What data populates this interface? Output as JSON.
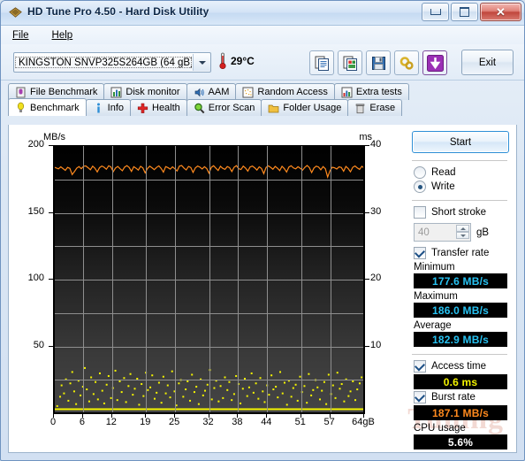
{
  "window": {
    "title": "HD Tune Pro 4.50 - Hard Disk Utility",
    "app_icon": "hdtune-diamond-icon",
    "minimize_label": "",
    "maximize_label": "",
    "close_label": "✕"
  },
  "menu": {
    "items": [
      {
        "label": "File",
        "accel": "F"
      },
      {
        "label": "Help",
        "accel": "H"
      }
    ]
  },
  "toolbar": {
    "drive": "KINGSTON SNVP325S264GB (64 gB)",
    "temperature": "29°C",
    "thermometer_icon": "thermometer-icon",
    "buttons": [
      {
        "name": "copy-text-button",
        "icon": "copy-text-icon"
      },
      {
        "name": "copy-image-button",
        "icon": "copy-image-icon"
      },
      {
        "name": "save-button",
        "icon": "floppy-save-icon"
      },
      {
        "name": "settings-button",
        "icon": "gears-settings-icon"
      },
      {
        "name": "download-button",
        "icon": "purple-down-arrow-icon"
      }
    ],
    "exit_label": "Exit"
  },
  "tabs": {
    "row_top": [
      {
        "label": "File Benchmark",
        "icon": "file-benchmark-icon",
        "active": false
      },
      {
        "label": "Disk monitor",
        "icon": "disk-monitor-icon",
        "active": false
      },
      {
        "label": "AAM",
        "icon": "speaker-icon",
        "active": false
      },
      {
        "label": "Random Access",
        "icon": "random-access-icon",
        "active": false
      },
      {
        "label": "Extra tests",
        "icon": "extra-tests-icon",
        "active": false
      }
    ],
    "row_bottom": [
      {
        "label": "Benchmark",
        "icon": "benchmark-bulb-icon",
        "active": true
      },
      {
        "label": "Info",
        "icon": "info-icon",
        "active": false
      },
      {
        "label": "Health",
        "icon": "health-cross-icon",
        "active": false
      },
      {
        "label": "Error Scan",
        "icon": "magnifier-icon",
        "active": false
      },
      {
        "label": "Folder Usage",
        "icon": "folder-icon",
        "active": false
      },
      {
        "label": "Erase",
        "icon": "trash-icon",
        "active": false
      }
    ]
  },
  "side_panel": {
    "start_label": "Start",
    "mode": {
      "read_label": "Read",
      "write_label": "Write",
      "selected": "Write"
    },
    "short_stroke": {
      "label": "Short stroke",
      "checked": false,
      "value": "40",
      "unit": "gB"
    },
    "transfer_rate": {
      "label": "Transfer rate",
      "checked": true,
      "minimum_label": "Minimum",
      "minimum_value": "177.6 MB/s",
      "maximum_label": "Maximum",
      "maximum_value": "186.0 MB/s",
      "average_label": "Average",
      "average_value": "182.9 MB/s"
    },
    "access_time": {
      "label": "Access time",
      "checked": true,
      "value": "0.6 ms"
    },
    "burst_rate": {
      "label": "Burst rate",
      "checked": true,
      "value": "187.1 MB/s"
    },
    "cpu_usage": {
      "label": "CPU usage",
      "value": "5.6%"
    }
  },
  "watermark": {
    "text_a": "itn",
    "text_b": "Tuning"
  },
  "chart_data": {
    "type": "line",
    "title": "",
    "left_axis_label": "MB/s",
    "right_axis_label": "ms",
    "xlabel": "",
    "x_unit": "gB",
    "x_max_label": "64gB",
    "xticks": [
      "0",
      "6",
      "12",
      "19",
      "25",
      "32",
      "38",
      "44",
      "51",
      "57",
      "64gB"
    ],
    "xtick_values": [
      0,
      6,
      12,
      19,
      25,
      32,
      38,
      44,
      51,
      57,
      64
    ],
    "yticks_left": [
      50,
      100,
      150,
      200
    ],
    "yticks_right": [
      10,
      20,
      30,
      40
    ],
    "ylim_left": [
      0,
      200
    ],
    "ylim_right": [
      0,
      40
    ],
    "xlim": [
      0,
      64
    ],
    "grid": true,
    "legend": "none",
    "series": [
      {
        "name": "Transfer rate",
        "color": "#ff8a1e",
        "axis": "left",
        "unit": "MB/s",
        "values": [
          184.2,
          183.6,
          182.9,
          184.4,
          183.1,
          181.8,
          184.0,
          183.2,
          178.6,
          180.9,
          183.4,
          184.6,
          183.0,
          184.8,
          185.1,
          183.7,
          182.2,
          184.9,
          183.3,
          180.6,
          183.8,
          185.0,
          184.1,
          182.6,
          185.2,
          184.3,
          180.8,
          183.5,
          184.7,
          183.0,
          181.5,
          184.2,
          185.3,
          183.9,
          181.0,
          184.5,
          183.4,
          182.0,
          184.8,
          183.6,
          179.9,
          183.1,
          184.9,
          183.7,
          182.3,
          184.0,
          185.1,
          183.2,
          180.4,
          184.6,
          183.8,
          182.7,
          184.4,
          183.0,
          181.3,
          184.9,
          185.4,
          183.5,
          182.1,
          184.7,
          183.9,
          180.2,
          183.6,
          185.0,
          184.2,
          182.8,
          184.5,
          183.1,
          179.6,
          184.0,
          185.2,
          183.4,
          181.7,
          184.8,
          183.3,
          182.5,
          184.6,
          183.8,
          180.9,
          184.1,
          185.3,
          183.0,
          182.4,
          184.9,
          183.5,
          181.2,
          184.3,
          185.0,
          183.7,
          182.0,
          184.4,
          183.2,
          179.3,
          183.9,
          185.1,
          184.0,
          182.6,
          184.7,
          183.4,
          181.6,
          184.8,
          183.1,
          180.5,
          184.2,
          185.2,
          183.6,
          182.9,
          184.5,
          183.3,
          181.9,
          184.0,
          185.4,
          183.8,
          180.1,
          183.5,
          184.9,
          184.3,
          182.2,
          184.6,
          183.0,
          176.8,
          181.4,
          184.1,
          183.7,
          182.8,
          184.4,
          183.9,
          181.1,
          184.7,
          183.2,
          180.7,
          184.0,
          185.0,
          183.6,
          182.5,
          184.8,
          183.4
        ]
      },
      {
        "name": "Access time",
        "color": "#f4f400",
        "axis": "right",
        "unit": "ms",
        "mode": "scatter",
        "baseline_ms": 0.6,
        "scatter_points": [
          [
            0.5,
            1.2
          ],
          [
            1.1,
            2.6
          ],
          [
            1.4,
            4.3
          ],
          [
            1.9,
            3.1
          ],
          [
            2.3,
            5.2
          ],
          [
            2.8,
            2.0
          ],
          [
            3.2,
            4.6
          ],
          [
            3.6,
            6.3
          ],
          [
            4.0,
            3.4
          ],
          [
            4.4,
            1.5
          ],
          [
            4.9,
            5.0
          ],
          [
            5.3,
            2.8
          ],
          [
            5.8,
            4.1
          ],
          [
            6.2,
            6.9
          ],
          [
            6.6,
            3.7
          ],
          [
            7.1,
            1.9
          ],
          [
            7.5,
            5.5
          ],
          [
            8.0,
            3.0
          ],
          [
            8.4,
            4.8
          ],
          [
            8.9,
            2.2
          ],
          [
            9.3,
            6.1
          ],
          [
            9.8,
            3.5
          ],
          [
            10.2,
            1.6
          ],
          [
            10.7,
            4.4
          ],
          [
            11.1,
            5.7
          ],
          [
            11.6,
            2.4
          ],
          [
            12.0,
            3.9
          ],
          [
            12.5,
            6.5
          ],
          [
            12.9,
            2.1
          ],
          [
            13.4,
            4.9
          ],
          [
            13.8,
            3.3
          ],
          [
            14.3,
            5.4
          ],
          [
            14.7,
            1.8
          ],
          [
            15.2,
            4.2
          ],
          [
            15.6,
            6.0
          ],
          [
            16.1,
            2.9
          ],
          [
            16.5,
            3.8
          ],
          [
            17.0,
            5.3
          ],
          [
            17.4,
            1.4
          ],
          [
            17.9,
            4.5
          ],
          [
            18.3,
            2.7
          ],
          [
            18.8,
            6.2
          ],
          [
            19.2,
            3.6
          ],
          [
            19.7,
            4.0
          ],
          [
            20.1,
            5.8
          ],
          [
            20.6,
            2.3
          ],
          [
            21.0,
            3.2
          ],
          [
            21.5,
            4.7
          ],
          [
            22.0,
            1.7
          ],
          [
            22.4,
            5.6
          ],
          [
            22.9,
            3.1
          ],
          [
            23.3,
            4.3
          ],
          [
            23.8,
            2.5
          ],
          [
            24.2,
            6.4
          ],
          [
            24.7,
            3.4
          ],
          [
            25.1,
            1.3
          ],
          [
            25.6,
            4.6
          ],
          [
            26.0,
            5.1
          ],
          [
            26.5,
            2.6
          ],
          [
            27.0,
            3.7
          ],
          [
            27.4,
            4.9
          ],
          [
            27.9,
            2.0
          ],
          [
            28.3,
            5.9
          ],
          [
            28.8,
            3.3
          ],
          [
            29.2,
            4.1
          ],
          [
            29.7,
            1.5
          ],
          [
            30.1,
            5.2
          ],
          [
            30.6,
            2.8
          ],
          [
            31.0,
            3.5
          ],
          [
            31.5,
            4.4
          ],
          [
            32.0,
            6.6
          ],
          [
            32.4,
            2.2
          ],
          [
            32.9,
            3.9
          ],
          [
            33.3,
            5.0
          ],
          [
            33.8,
            1.9
          ],
          [
            34.2,
            4.2
          ],
          [
            34.7,
            2.4
          ],
          [
            35.1,
            5.5
          ],
          [
            35.6,
            3.6
          ],
          [
            36.0,
            4.8
          ],
          [
            36.5,
            2.1
          ],
          [
            37.0,
            3.0
          ],
          [
            37.4,
            5.7
          ],
          [
            37.9,
            4.5
          ],
          [
            38.3,
            1.6
          ],
          [
            38.8,
            3.8
          ],
          [
            39.2,
            5.3
          ],
          [
            39.7,
            2.7
          ],
          [
            40.1,
            4.0
          ],
          [
            40.6,
            6.1
          ],
          [
            41.0,
            3.2
          ],
          [
            41.5,
            4.6
          ],
          [
            42.0,
            2.3
          ],
          [
            42.4,
            5.4
          ],
          [
            42.9,
            3.4
          ],
          [
            43.3,
            1.8
          ],
          [
            43.8,
            4.3
          ],
          [
            44.2,
            2.9
          ],
          [
            44.7,
            5.8
          ],
          [
            45.1,
            3.7
          ],
          [
            45.6,
            4.1
          ],
          [
            46.0,
            2.5
          ],
          [
            46.5,
            6.3
          ],
          [
            47.0,
            3.1
          ],
          [
            47.4,
            4.7
          ],
          [
            47.9,
            1.4
          ],
          [
            48.3,
            5.0
          ],
          [
            48.8,
            2.6
          ],
          [
            49.2,
            3.9
          ],
          [
            49.7,
            4.4
          ],
          [
            50.1,
            2.0
          ],
          [
            50.6,
            5.6
          ],
          [
            51.0,
            3.3
          ],
          [
            51.5,
            4.2
          ],
          [
            52.0,
            1.7
          ],
          [
            52.4,
            6.0
          ],
          [
            52.9,
            2.8
          ],
          [
            53.3,
            3.6
          ],
          [
            53.8,
            5.1
          ],
          [
            54.2,
            4.0
          ],
          [
            54.7,
            2.2
          ],
          [
            55.1,
            3.5
          ],
          [
            55.6,
            4.8
          ],
          [
            56.0,
            1.5
          ],
          [
            56.5,
            5.9
          ],
          [
            57.0,
            3.0
          ],
          [
            57.4,
            4.3
          ],
          [
            57.9,
            2.4
          ],
          [
            58.3,
            6.2
          ],
          [
            58.8,
            3.8
          ],
          [
            59.2,
            4.5
          ],
          [
            59.7,
            1.9
          ],
          [
            60.1,
            5.2
          ],
          [
            60.6,
            2.7
          ],
          [
            61.0,
            3.4
          ],
          [
            61.5,
            4.9
          ],
          [
            62.0,
            2.1
          ],
          [
            62.4,
            3.7
          ],
          [
            62.9,
            4.6
          ],
          [
            63.3,
            5.5
          ]
        ]
      }
    ]
  }
}
